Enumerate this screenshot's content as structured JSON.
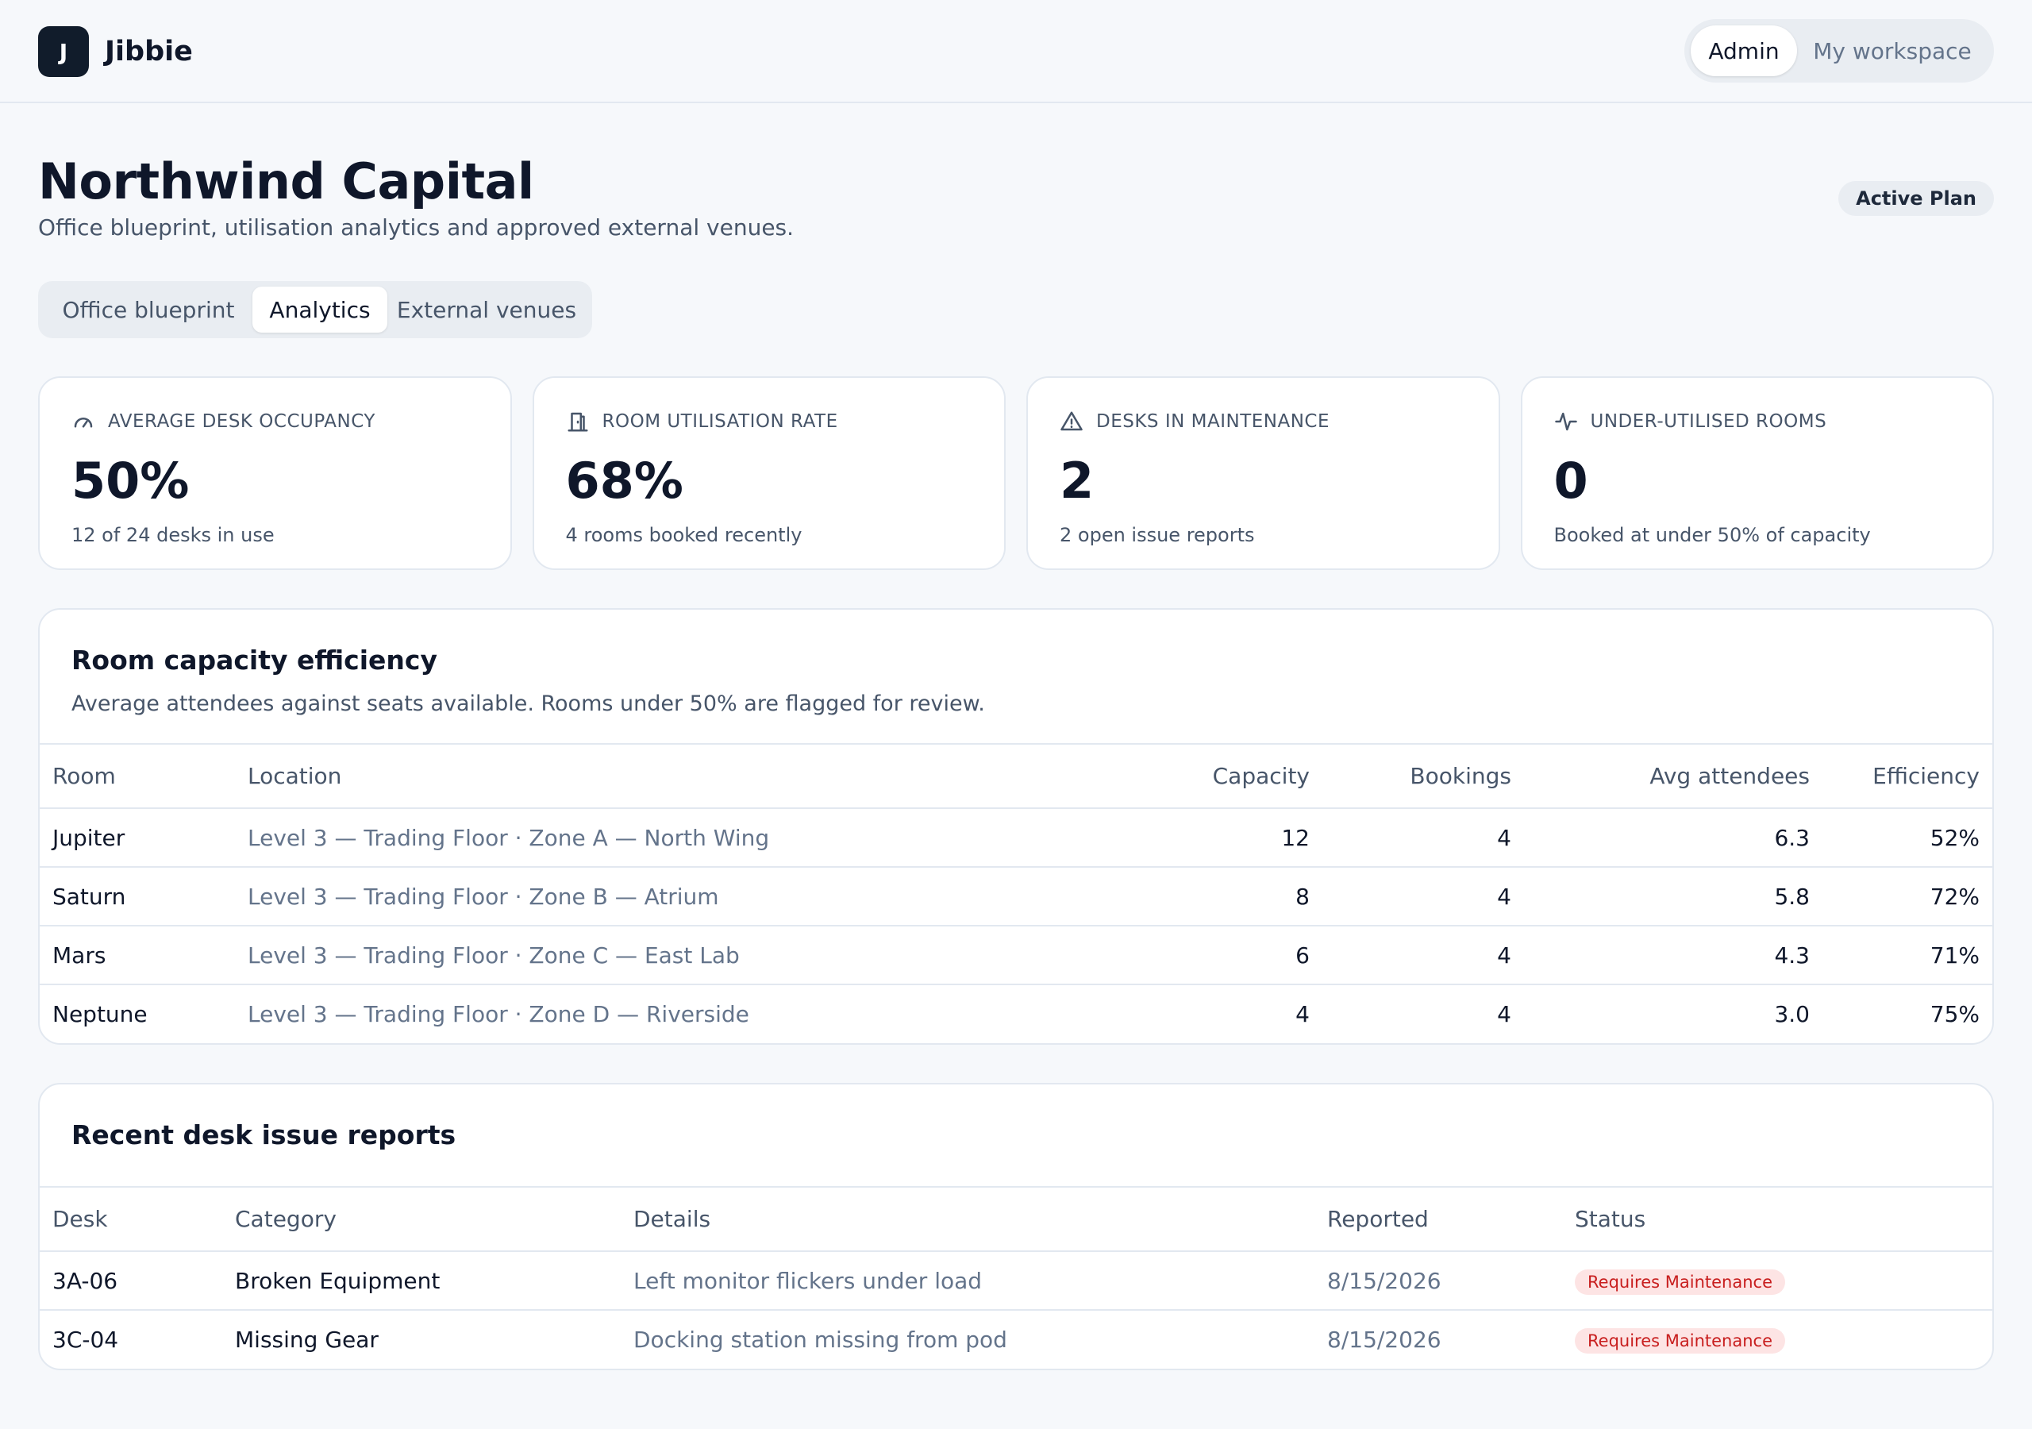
{
  "app": {
    "logo_letter": "J",
    "name": "Jibbie",
    "modes": [
      {
        "label": "Admin",
        "active": true
      },
      {
        "label": "My workspace",
        "active": false
      }
    ]
  },
  "header": {
    "title": "Northwind Capital",
    "subtitle": "Office blueprint, utilisation analytics and approved external venues.",
    "plan_badge": "Active Plan"
  },
  "tabs": [
    {
      "label": "Office blueprint",
      "active": false
    },
    {
      "label": "Analytics",
      "active": true
    },
    {
      "label": "External venues",
      "active": false
    }
  ],
  "stats": [
    {
      "icon": "gauge-icon",
      "label": "AVERAGE DESK OCCUPANCY",
      "value": "50%",
      "note": "12 of 24 desks in use"
    },
    {
      "icon": "door-icon",
      "label": "ROOM UTILISATION RATE",
      "value": "68%",
      "note": "4 rooms booked recently"
    },
    {
      "icon": "warning-icon",
      "label": "DESKS IN MAINTENANCE",
      "value": "2",
      "note": "2 open issue reports"
    },
    {
      "icon": "activity-icon",
      "label": "UNDER-UTILISED ROOMS",
      "value": "0",
      "note": "Booked at under 50% of capacity"
    }
  ],
  "rooms_panel": {
    "title": "Room capacity efficiency",
    "description": "Average attendees against seats available. Rooms under 50% are flagged for review.",
    "columns": [
      "Room",
      "Location",
      "Capacity",
      "Bookings",
      "Avg attendees",
      "Efficiency"
    ],
    "rows": [
      [
        "Jupiter",
        "Level 3 — Trading Floor · Zone A — North Wing",
        "12",
        "4",
        "6.3",
        "52%"
      ],
      [
        "Saturn",
        "Level 3 — Trading Floor · Zone B — Atrium",
        "8",
        "4",
        "5.8",
        "72%"
      ],
      [
        "Mars",
        "Level 3 — Trading Floor · Zone C — East Lab",
        "6",
        "4",
        "4.3",
        "71%"
      ],
      [
        "Neptune",
        "Level 3 — Trading Floor · Zone D — Riverside",
        "4",
        "4",
        "3.0",
        "75%"
      ]
    ]
  },
  "issues_panel": {
    "title": "Recent desk issue reports",
    "columns": [
      "Desk",
      "Category",
      "Details",
      "Reported",
      "Status"
    ],
    "rows": [
      [
        "3A-06",
        "Broken Equipment",
        "Left monitor flickers under load",
        "8/15/2026",
        "Requires Maintenance"
      ],
      [
        "3C-04",
        "Missing Gear",
        "Docking station missing from pod",
        "8/15/2026",
        "Requires Maintenance"
      ]
    ]
  },
  "colors": {
    "background": "#f6f8fb",
    "brand_dark": "#111c2b",
    "status_bg": "#fde4e4",
    "status_text": "#c81e1e"
  }
}
